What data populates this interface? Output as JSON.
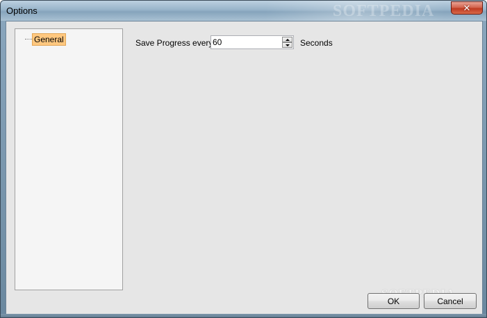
{
  "window": {
    "title": "Options",
    "watermark": "SOFTPEDIA",
    "close_glyph": "✕"
  },
  "tree": {
    "items": [
      {
        "label": "General",
        "selected": true
      }
    ]
  },
  "settings": {
    "save_progress_label": "Save Progress every",
    "save_progress_value": "60",
    "unit_label": "Seconds"
  },
  "footer": {
    "watermark": "SOFTPEDIA",
    "ok_label": "OK",
    "cancel_label": "Cancel"
  },
  "icons": {
    "spin_up": "triangle-up",
    "spin_down": "triangle-down",
    "close": "x-mark"
  },
  "colors": {
    "selection": "#ffc880",
    "close_button": "#c8472e",
    "client_background": "#e6e6e6"
  }
}
